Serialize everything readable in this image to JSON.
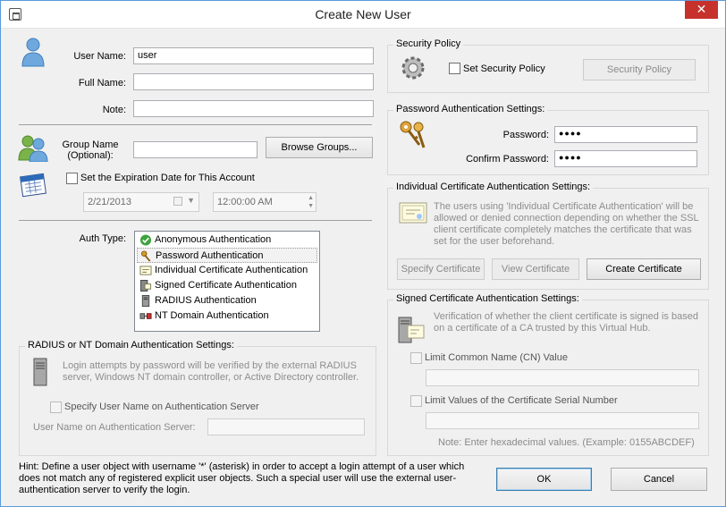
{
  "window": {
    "title": "Create New User",
    "close_symbol": "✕"
  },
  "user": {
    "user_name_label": "User Name:",
    "user_name_value": "user",
    "full_name_label": "Full Name:",
    "full_name_value": "",
    "note_label": "Note:",
    "note_value": ""
  },
  "group": {
    "label_line1": "Group Name",
    "label_line2": "(Optional):",
    "value": "",
    "browse_button": "Browse Groups..."
  },
  "expiration": {
    "checkbox_label": "Set the Expiration Date for This Account",
    "checked": false,
    "date": "2/21/2013",
    "time": "12:00:00 AM"
  },
  "auth": {
    "label": "Auth Type:",
    "options": [
      {
        "label": "Anonymous Authentication",
        "icon": "green-check-icon"
      },
      {
        "label": "Password Authentication",
        "icon": "keys-icon",
        "selected": true
      },
      {
        "label": "Individual Certificate Authentication",
        "icon": "certificate-icon"
      },
      {
        "label": "Signed Certificate Authentication",
        "icon": "signed-certificate-icon"
      },
      {
        "label": "RADIUS Authentication",
        "icon": "server-icon"
      },
      {
        "label": "NT Domain Authentication",
        "icon": "network-icon"
      }
    ]
  },
  "radius": {
    "title": "RADIUS or NT Domain Authentication Settings:",
    "description": "Login attempts by password will be verified by the external RADIUS server, Windows NT domain controller, or Active Directory controller.",
    "specify_label": "Specify User Name on Authentication Server",
    "server_label": "User Name on Authentication Server:",
    "server_value": ""
  },
  "hint": "Hint: Define a user object with username '*' (asterisk) in order to accept a login attempt of a user which does not match any of registered explicit user objects. Such a special user will use the external user-authentication server to verify the login.",
  "security_policy": {
    "title": "Security Policy",
    "checkbox_label": "Set Security Policy",
    "button": "Security Policy"
  },
  "password_auth": {
    "title": "Password Authentication Settings:",
    "password_label": "Password:",
    "password_value": "●●●●",
    "confirm_label": "Confirm Password:",
    "confirm_value": "●●●●"
  },
  "individual_cert": {
    "title": "Individual Certificate Authentication Settings:",
    "description": "The users using 'Individual Certificate Authentication' will be allowed or denied connection depending on whether the SSL client certificate completely matches the certificate that was set for the user beforehand.",
    "specify_button": "Specify Certificate",
    "view_button": "View Certificate",
    "create_button": "Create Certificate"
  },
  "signed_cert": {
    "title": "Signed Certificate Authentication Settings:",
    "description": "Verification of whether the client certificate is signed is based on a certificate of a CA trusted by this Virtual Hub.",
    "limit_cn_label": "Limit Common Name (CN) Value",
    "limit_cn_value": "",
    "limit_serial_label": "Limit Values of the Certificate Serial Number",
    "limit_serial_value": "",
    "note": "Note: Enter hexadecimal values. (Example: 0155ABCDEF)"
  },
  "buttons": {
    "ok": "OK",
    "cancel": "Cancel"
  },
  "colors": {
    "accent": "#3c7fb1",
    "close": "#c7312b",
    "border": "#5a9ad8"
  }
}
